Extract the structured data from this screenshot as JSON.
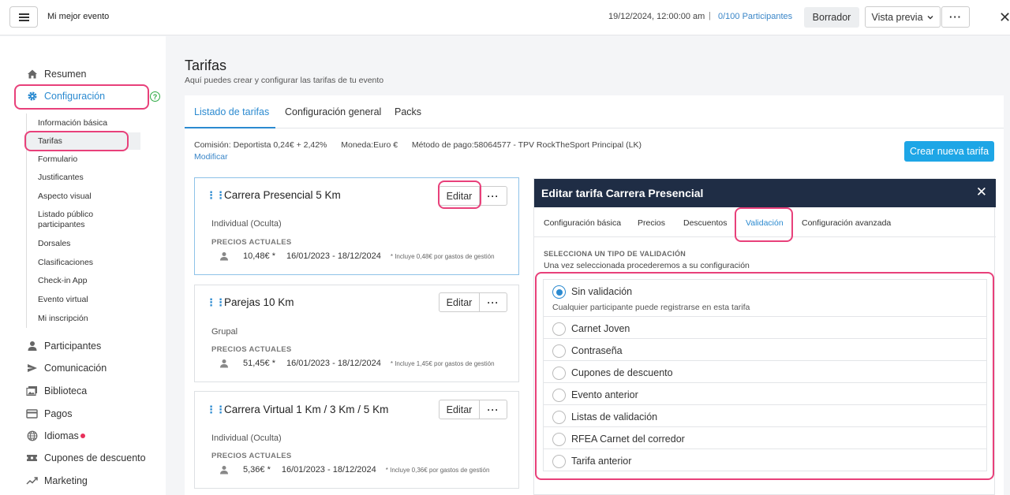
{
  "topbar": {
    "event_name": "Mi mejor evento",
    "datetime": "19/12/2024, 12:00:00 am",
    "separator": "|",
    "participants": "0/100 Participantes",
    "status_button": "Borrador",
    "preview_button": "Vista previa",
    "more": "···",
    "close": "✕"
  },
  "sidebar": {
    "main_top": [
      {
        "label": "Resumen",
        "icon": "home-icon"
      },
      {
        "label": "Configuración",
        "icon": "gear-icon"
      }
    ],
    "sub_items": [
      "Información básica",
      "Tarifas",
      "Formulario",
      "Justificantes",
      "Aspecto visual",
      "Listado público participantes",
      "Dorsales",
      "Clasificaciones",
      "Check-in App",
      "Evento virtual",
      "Mi inscripción"
    ],
    "main_bottom": [
      {
        "label": "Participantes",
        "icon": "user-icon"
      },
      {
        "label": "Comunicación",
        "icon": "send-icon"
      },
      {
        "label": "Biblioteca",
        "icon": "images-icon"
      },
      {
        "label": "Pagos",
        "icon": "card-icon"
      },
      {
        "label": "Idiomas",
        "icon": "globe-icon"
      },
      {
        "label": "Cupones de descuento",
        "icon": "ticket-icon"
      },
      {
        "label": "Marketing",
        "icon": "trend-icon"
      }
    ],
    "help": "?"
  },
  "page": {
    "title": "Tarifas",
    "subtitle": "Aquí puedes crear y configurar las tarifas de tu evento"
  },
  "tabs": [
    "Listado de tarifas",
    "Configuración general",
    "Packs"
  ],
  "info": {
    "comision_label": "Comisión:",
    "comision_value": "Deportista 0,24€ + 2,42%",
    "moneda_label": "Moneda:",
    "moneda_value": "Euro €",
    "metodo_label": "Método de pago:",
    "metodo_value": "58064577 - TPV RockTheSport Principal (LK)",
    "modificar": "Modificar",
    "crear_button": "Crear nueva tarifa"
  },
  "tarifas": [
    {
      "title": "Carrera Presencial 5 Km",
      "type": "Individual (Oculta)",
      "prices_label": "PRECIOS ACTUALES",
      "price": "10,48€ *",
      "dates": "16/01/2023 - 18/12/2024",
      "note": "* Incluye 0,48€ por gastos de gestión",
      "edit": "Editar",
      "more": "···"
    },
    {
      "title": "Parejas 10 Km",
      "type": "Grupal",
      "prices_label": "PRECIOS ACTUALES",
      "price": "51,45€ *",
      "dates": "16/01/2023 - 18/12/2024",
      "note": "* Incluye 1,45€ por gastos de gestión",
      "edit": "Editar",
      "more": "···"
    },
    {
      "title": "Carrera Virtual 1 Km / 3 Km / 5 Km",
      "type": "Individual (Oculta)",
      "prices_label": "PRECIOS ACTUALES",
      "price": "5,36€ *",
      "dates": "16/01/2023 - 18/12/2024",
      "note": "* Incluye 0,36€ por gastos de gestión",
      "edit": "Editar",
      "more": "···"
    }
  ],
  "panel": {
    "title": "Editar tarifa Carrera Presencial",
    "close": "✕",
    "tabs": [
      "Configuración básica",
      "Precios",
      "Descuentos",
      "Validación",
      "Configuración avanzada"
    ],
    "section_label": "SELECCIONA UN TIPO DE VALIDACIÓN",
    "section_desc": "Una vez seleccionada procederemos a su configuración",
    "options": [
      {
        "label": "Sin validación",
        "desc": "Cualquier participante puede registrarse en esta tarifa",
        "selected": true
      },
      {
        "label": "Carnet Joven"
      },
      {
        "label": "Contraseña"
      },
      {
        "label": "Cupones de descuento"
      },
      {
        "label": "Evento anterior"
      },
      {
        "label": "Listas de validación"
      },
      {
        "label": "RFEA Carnet del corredor"
      },
      {
        "label": "Tarifa anterior"
      }
    ]
  },
  "colors": {
    "accent": "#2b8ad0",
    "highlight": "#e8407a",
    "header_dark": "#1f2d45",
    "primary_button": "#1ea6e6"
  }
}
